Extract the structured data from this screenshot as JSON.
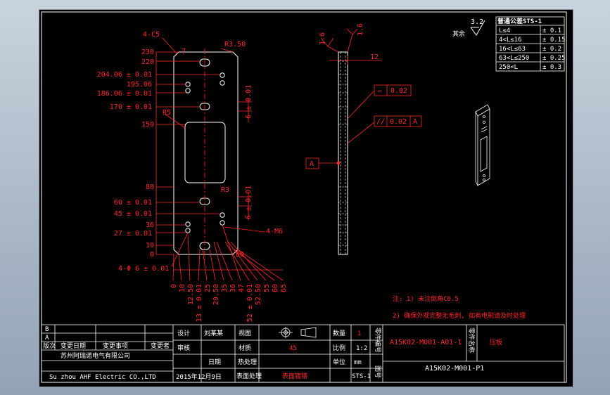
{
  "colors": {
    "dim": "#ff2a2a",
    "line": "#ffffff",
    "paper": "#000000"
  },
  "part_dims": {
    "chamfer": "4-C5",
    "radius_top": "R3.50",
    "radius_inner": "R5",
    "radius_bottom": "R3",
    "top_total": "230",
    "top_minus": "220",
    "y204": "204.06 ± 0.01",
    "y195": "195.06",
    "y186": "186.06 ± 0.01",
    "y170": "170 ± 0.01",
    "y150": "150",
    "y80": "80",
    "y60": "60 ± 0.01",
    "y45": "45 ± 0.01",
    "y36": "36",
    "y27": "27 ± 0.01",
    "y10": "10",
    "y0": "0",
    "holes": "4-Φ 6 ± 0.01",
    "tap": "4-M6",
    "slot_upper": "6 ± 0.01",
    "slot_lower": "6 ± 0.01",
    "right_50": "50",
    "d7": "7",
    "bottom_x": [
      "0",
      "10",
      "12.50",
      "13 ± 0.01",
      "25",
      "29.50",
      "35",
      "36",
      "47",
      "52 ± 0.01",
      "52.50",
      "55",
      "60",
      "65"
    ]
  },
  "side_view": {
    "thickness": "12",
    "rough_left": "1.6",
    "rough_right": "1.6",
    "flatness_sym": "▱",
    "flatness_val": "0.02",
    "parallel_sym": "//",
    "parallel_val": "0.02",
    "parallel_datum": "A",
    "datum": "A"
  },
  "notes": {
    "line1": "注: 1) 未注倒角C0.5",
    "line2": "2) 确保外观完整无毛刺, 如有电刷请及时处理"
  },
  "roughness_general": {
    "value": "3.2",
    "label": "其余"
  },
  "tolerance_table": {
    "title": "普通公差STS-1",
    "rows": [
      {
        "range": "L≤4",
        "tol": "± 0.1"
      },
      {
        "range": "4<L≤16",
        "tol": "± 0.15"
      },
      {
        "range": "16<L≤63",
        "tol": "± 0.2"
      },
      {
        "range": "63<L≤250",
        "tol": "± 0.25"
      },
      {
        "range": "250<L",
        "tol": "± 0.3"
      }
    ]
  },
  "title_block": {
    "rev_b": "B",
    "rev_a": "A",
    "h_ver": "版次",
    "h_date": "变更日期",
    "h_item": "变更事项",
    "h_by": "变更者",
    "company_cn": "苏州阿瑞诺电气有限公司",
    "company_en": "Su zhou AHF Electric CO.,LTD",
    "date_val": "2015年12月9日",
    "design_label": "设计",
    "design_name": "刘某某",
    "check_label": "审核",
    "date_label": "日期",
    "qty_label": "数量",
    "qty_val": "1",
    "material_label": "材质",
    "material_val": "45",
    "scale_label": "比例",
    "scale_val": "1:2",
    "heat_label": "热处理",
    "unit_label": "单位",
    "unit_val": "mm",
    "surface_label": "表面处理",
    "surface_val": "表面镀铬",
    "std_val": "STS-1",
    "part_no_label": "零件编号",
    "part_no": "A15K02-M001-A01-1",
    "drawing_no_label": "图号",
    "drawing_no": "A15K02-M001-P1",
    "part_name_label": "零件名称",
    "part_name": "压板"
  }
}
